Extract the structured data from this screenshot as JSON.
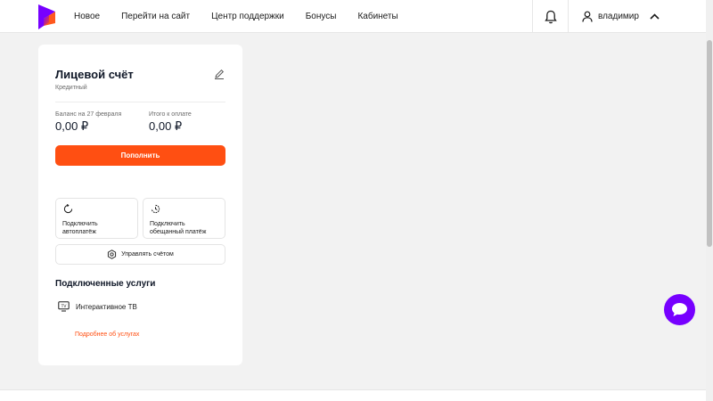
{
  "header": {
    "nav": [
      "Новое",
      "Перейти на сайт",
      "Центр поддержки",
      "Бонусы",
      "Кабинеты"
    ],
    "user_name": "владимир",
    "icons": [
      "logo",
      "bell-icon",
      "user-icon",
      "chevron-up-icon"
    ]
  },
  "account_card": {
    "title": "Лицевой счёт",
    "subtitle": "Кредитный",
    "balance_label": "Баланс на 27 февраля",
    "balance_value": "0,00 ₽",
    "due_label": "Итого к оплате",
    "due_value": "0,00 ₽",
    "topup_label": "Пополнить",
    "tiles": [
      {
        "label": "Подключить\nавтоплатёж",
        "icon": "refresh-icon"
      },
      {
        "label": "Подключить\nобещанный платёж",
        "icon": "clock-icon"
      }
    ],
    "manage_label": "Управлять счётом"
  },
  "services": {
    "title": "Подключенные услуги",
    "items": [
      {
        "label": "Интерактивное ТВ",
        "icon": "tv-icon"
      }
    ],
    "more_link": "Подробнее об услугах"
  },
  "colors": {
    "accent": "#ff4f12",
    "chat": "#7700ff",
    "brand_logo": "#7700ff"
  }
}
